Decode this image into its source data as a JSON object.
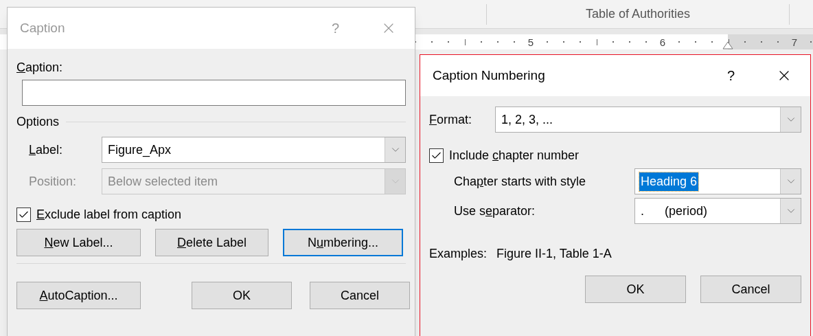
{
  "ribbon": {
    "group_label": "Table of Authorities"
  },
  "ruler": {
    "numbers": [
      "5",
      "6",
      "7"
    ]
  },
  "caption_dialog": {
    "title": "Caption",
    "active": false,
    "help": "?",
    "caption_field": {
      "label": {
        "key": "C",
        "post": "aption:"
      }
    },
    "options_heading": "Options",
    "fields": [
      {
        "label": {
          "key": "L",
          "post": "abel:"
        },
        "value": "Figure_Apx",
        "disabled": false
      },
      {
        "label": {
          "text": "Position:"
        },
        "value": "Below selected item",
        "disabled": true
      }
    ],
    "checkbox": {
      "label": {
        "key": "E",
        "post": "xclude label from caption"
      },
      "checked": true
    },
    "label_buttons": [
      {
        "label": {
          "key": "N",
          "post": "ew Label..."
        },
        "focused": false
      },
      {
        "label": {
          "key": "D",
          "post": "elete Label"
        },
        "focused": false
      },
      {
        "label": {
          "pre": "N",
          "key": "u",
          "post": "mbering..."
        },
        "focused": true
      }
    ],
    "bottom_buttons": [
      {
        "label": {
          "key": "A",
          "post": "utoCaption..."
        },
        "focused": false
      },
      {
        "label": {
          "text": "OK"
        },
        "focused": false
      },
      {
        "label": {
          "text": "Cancel"
        },
        "focused": false
      }
    ]
  },
  "numbering_dialog": {
    "title": "Caption Numbering",
    "active": true,
    "help": "?",
    "format": {
      "label": {
        "key": "F",
        "post": "ormat:"
      },
      "value": "1, 2, 3, ..."
    },
    "checkbox": {
      "label": {
        "pre": "Include ",
        "key": "c",
        "post": "hapter number"
      },
      "checked": true
    },
    "sub_fields": [
      {
        "label": {
          "pre": "Cha",
          "key": "p",
          "post": "ter starts with style"
        },
        "value": "Heading 6",
        "selected": true
      },
      {
        "label": {
          "pre": "Use s",
          "key": "e",
          "post": "parator:"
        },
        "value": ".      (period)",
        "selected": false
      }
    ],
    "examples_label": "Examples:",
    "examples_value": "Figure II-1, Table 1-A",
    "buttons": [
      {
        "label": {
          "text": "OK"
        }
      },
      {
        "label": {
          "text": "Cancel"
        }
      }
    ]
  }
}
